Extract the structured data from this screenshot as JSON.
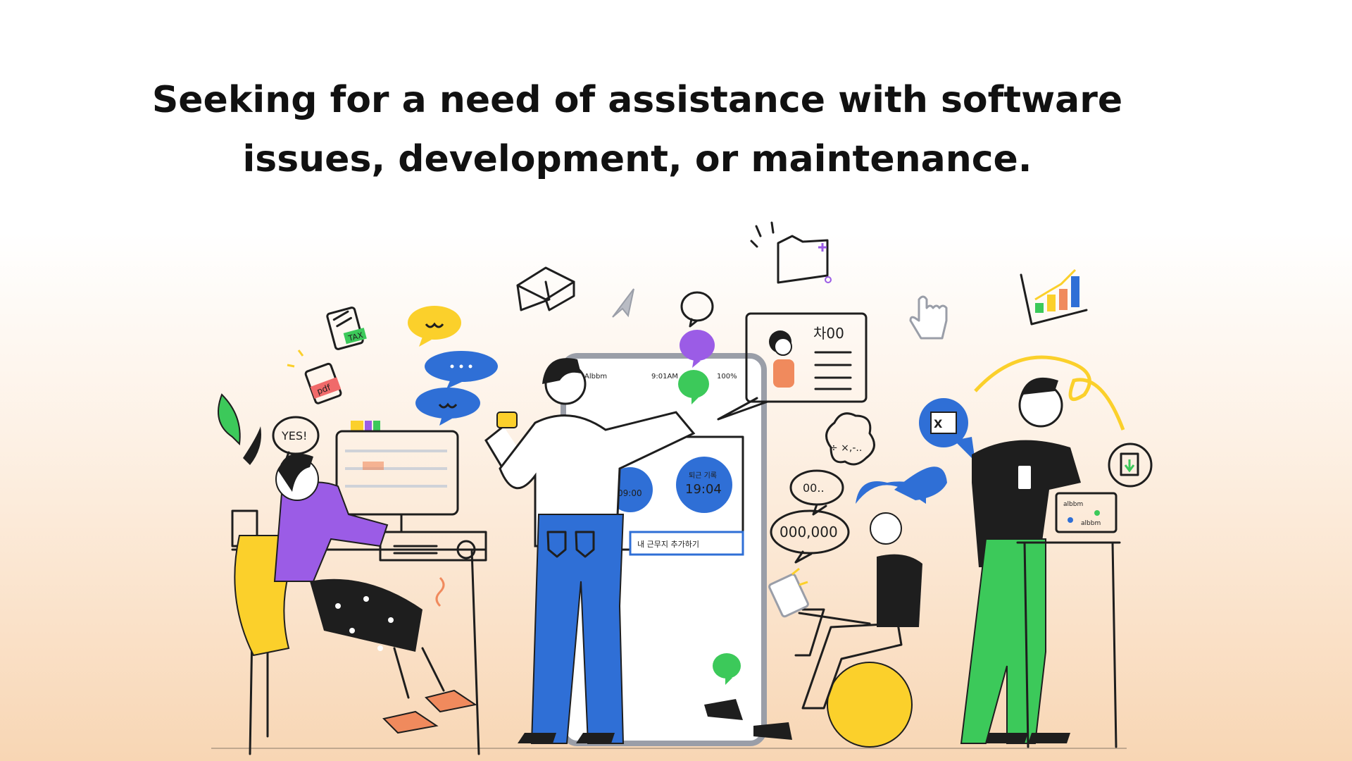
{
  "headline": {
    "line1": "Seeking for a need of assistance with software",
    "line2": "issues, development, or maintenance."
  },
  "illustration": {
    "speech_yes": "YES!",
    "speech_oo": "00..",
    "speech_money": "000,000",
    "profile_card_title": "차00",
    "tablet_status_left": "Albbm",
    "tablet_status_time": "9:01AM",
    "tablet_status_right": "100%",
    "tablet_badge_small": "09:00",
    "tablet_badge_caption": "퇴근 기록",
    "tablet_badge_time": "19:04",
    "tablet_button": "내 근무지 추가하기",
    "tax_label": "TAX",
    "pdf_label": "pdf",
    "excel_label": "X",
    "laptop_label_top": "albbm",
    "laptop_label_bottom": "albbm",
    "math_bubble": "÷ ×,-.."
  },
  "colors": {
    "blue": "#2f6fd6",
    "yellow": "#fbd02b",
    "green": "#3cc95a",
    "purple": "#9b5ce6",
    "orange": "#f08a5d",
    "ink": "#1e1e1e"
  }
}
